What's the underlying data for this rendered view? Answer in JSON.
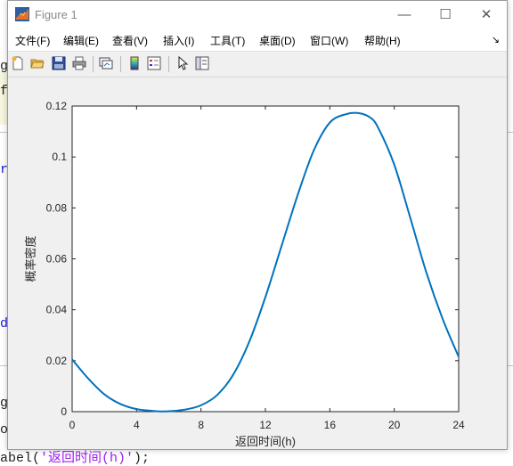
{
  "window": {
    "title": "Figure 1",
    "controls": {
      "minimize": "—",
      "maximize": "☐",
      "close": "✕"
    }
  },
  "menu": {
    "items": [
      "文件(F)",
      "编辑(E)",
      "查看(V)",
      "插入(I)",
      "工具(T)",
      "桌面(D)",
      "窗口(W)",
      "帮助(H)"
    ],
    "overflow": "↘"
  },
  "toolbar": {
    "icons": [
      "new-figure-icon",
      "open-file-icon",
      "save-icon",
      "print-icon",
      "link-plot-icon",
      "colorbar-icon",
      "legend-icon",
      "pointer-icon",
      "property-editor-icon"
    ]
  },
  "background_editor": {
    "fragments": [
      "g",
      "f",
      "r",
      "d",
      "g",
      "o"
    ],
    "bottom_line_prefix": "abel(",
    "bottom_line_string": "'返回时间(h)'",
    "bottom_line_suffix": ");"
  },
  "chart_data": {
    "type": "line",
    "title": "",
    "xlabel": "返回时间(h)",
    "ylabel": "概率密度",
    "xlim": [
      0,
      24
    ],
    "ylim": [
      0,
      0.12
    ],
    "xticks": [
      0,
      4,
      8,
      12,
      16,
      20,
      24
    ],
    "yticks": [
      0,
      0.02,
      0.04,
      0.06,
      0.08,
      0.1,
      0.12
    ],
    "line_color": "#0072bd",
    "series": [
      {
        "x": [
          0,
          1,
          2,
          3,
          4,
          5,
          5.8,
          7,
          8,
          9,
          10,
          11,
          12,
          13,
          14,
          15,
          16,
          17,
          17.8,
          18.5,
          19,
          20,
          21,
          22,
          23,
          24
        ],
        "values": [
          0.0205,
          0.013,
          0.0068,
          0.003,
          0.001,
          0.0003,
          0.0001,
          0.0008,
          0.0025,
          0.0065,
          0.0145,
          0.0275,
          0.045,
          0.065,
          0.085,
          0.1025,
          0.1135,
          0.1168,
          0.1172,
          0.1155,
          0.1115,
          0.097,
          0.076,
          0.0545,
          0.0365,
          0.0215
        ]
      }
    ]
  }
}
